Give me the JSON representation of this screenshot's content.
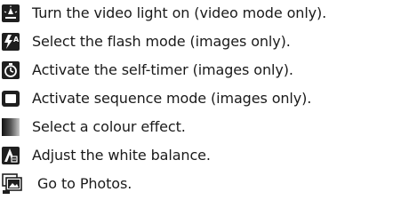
{
  "items": [
    {
      "icon": "video-light-icon",
      "text": "Turn the video light on (video mode only)."
    },
    {
      "icon": "flash-mode-icon",
      "text": "Select the flash mode (images only)."
    },
    {
      "icon": "self-timer-icon",
      "text": "Activate the self-timer (images only)."
    },
    {
      "icon": "sequence-mode-icon",
      "text": "Activate sequence mode (images only)."
    },
    {
      "icon": "colour-effect-icon",
      "text": "Select a colour effect."
    },
    {
      "icon": "white-balance-icon",
      "text": "Adjust the white balance."
    },
    {
      "icon": "photos-icon",
      "text": "Go to Photos."
    }
  ],
  "colors": {
    "icon_dark": "#1f1f1f",
    "icon_white": "#ffffff",
    "text": "#1a1a1a"
  }
}
